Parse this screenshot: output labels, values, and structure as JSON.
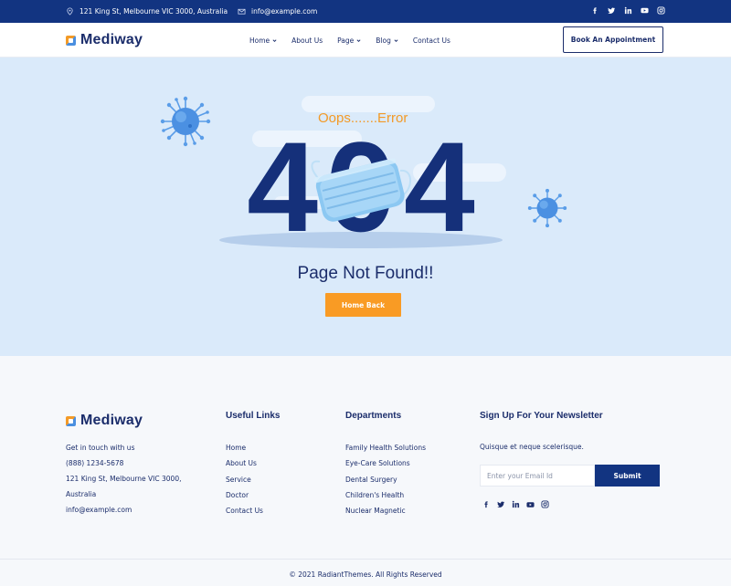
{
  "topbar": {
    "address": "121 King St, Melbourne VIC 3000, Australia",
    "email": "info@example.com",
    "social_icons": [
      "facebook-icon",
      "twitter-icon",
      "linkedin-icon",
      "youtube-icon",
      "instagram-icon"
    ]
  },
  "header": {
    "logo": "Mediway",
    "nav": [
      {
        "label": "Home",
        "dropdown": true
      },
      {
        "label": "About Us",
        "dropdown": false
      },
      {
        "label": "Page",
        "dropdown": true
      },
      {
        "label": "Blog",
        "dropdown": true
      },
      {
        "label": "Contact Us",
        "dropdown": false
      }
    ],
    "cta": "Book An Appointment"
  },
  "hero": {
    "oops": "Oops.......Error",
    "code": "404",
    "heading": "Page Not Found!!",
    "button": "Home Back"
  },
  "footer": {
    "logo": "Mediway",
    "contact": {
      "intro": "Get in touch with us",
      "phone": "(888) 1234-5678",
      "address_line1": "121 King St, Melbourne VIC 3000,",
      "address_line2": "Australia",
      "email": "info@example.com"
    },
    "useful_links": {
      "title": "Useful Links",
      "items": [
        "Home",
        "About Us",
        "Service",
        "Doctor",
        "Contact Us"
      ]
    },
    "departments": {
      "title": "Departments",
      "items": [
        "Family Health Solutions",
        "Eye-Care Solutions",
        "Dental Surgery",
        "Children's Health",
        "Nuclear Magnetic"
      ]
    },
    "newsletter": {
      "title": "Sign Up For Your Newsletter",
      "text": "Quisque et neque scelerisque.",
      "placeholder": "Enter your Email Id",
      "button": "Submit"
    },
    "copyright": "© 2021 RadiantThemes. All Rights Reserved"
  },
  "colors": {
    "navy": "#123481",
    "accent_orange": "#f99b24",
    "hero_bg": "#daeafa"
  }
}
